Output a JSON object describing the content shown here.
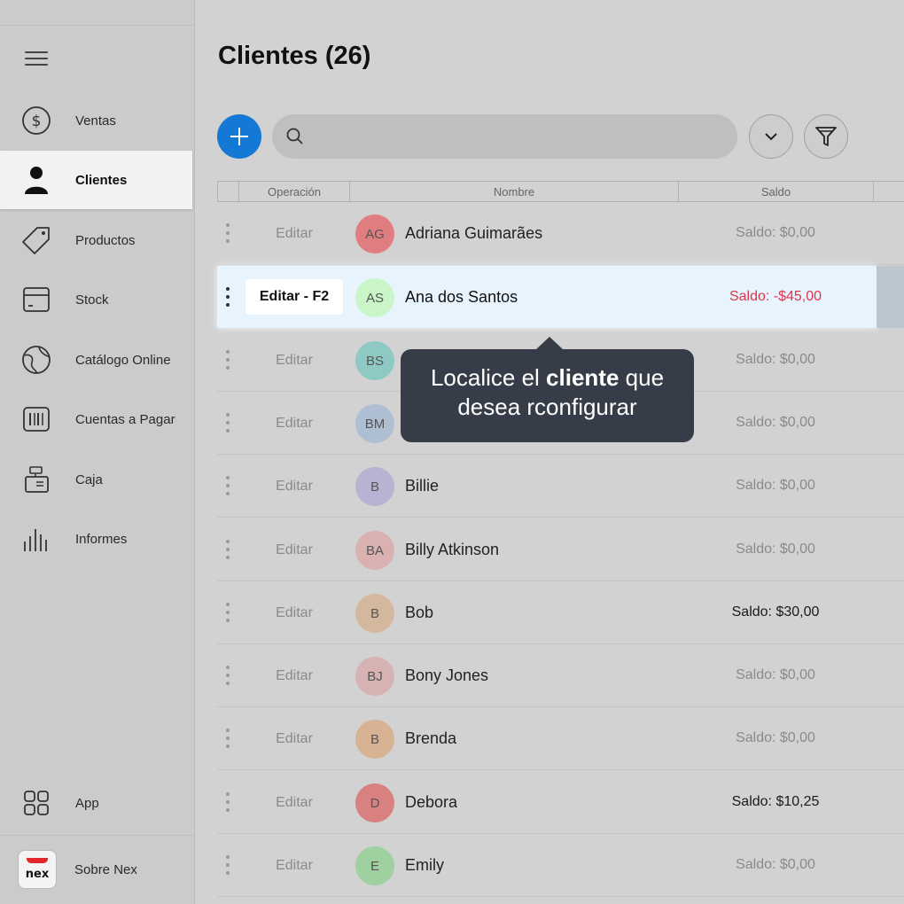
{
  "sidebar": {
    "items": [
      {
        "label": "Ventas",
        "icon": "dollar-circle-icon"
      },
      {
        "label": "Clientes",
        "icon": "person-icon"
      },
      {
        "label": "Productos",
        "icon": "tag-icon"
      },
      {
        "label": "Stock",
        "icon": "box-icon"
      },
      {
        "label": "Catálogo Online",
        "icon": "globe-icon"
      },
      {
        "label": "Cuentas a Pagar",
        "icon": "barcode-icon"
      },
      {
        "label": "Caja",
        "icon": "cash-register-icon"
      },
      {
        "label": "Informes",
        "icon": "bars-icon"
      }
    ],
    "active": "Clientes",
    "app_label": "App",
    "about_label": "Sobre Nex",
    "logo_text": "nex"
  },
  "main": {
    "title": "Clientes (26)",
    "search_placeholder": ""
  },
  "table": {
    "headers": [
      "Operación",
      "Nombre",
      "Saldo"
    ],
    "rows": [
      {
        "edit": "Editar",
        "initials": "AG",
        "name": "Adriana Guimarães",
        "saldo": "Saldo: $0,00",
        "avatar_color": "#e07d80",
        "saldo_style": "muted"
      },
      {
        "edit": "Editar - F2",
        "initials": "AS",
        "name": "Ana dos Santos",
        "saldo": "Saldo: -$45,00",
        "avatar_color": "#c9f5c8",
        "saldo_style": "negative",
        "highlighted": true
      },
      {
        "edit": "Editar",
        "initials": "BS",
        "name": "",
        "saldo": "Saldo: $0,00",
        "avatar_color": "#8ec9c4",
        "saldo_style": "muted"
      },
      {
        "edit": "Editar",
        "initials": "BM",
        "name": "",
        "saldo": "Saldo: $0,00",
        "avatar_color": "#aebfd3",
        "saldo_style": "muted"
      },
      {
        "edit": "Editar",
        "initials": "B",
        "name": "Billie",
        "saldo": "Saldo: $0,00",
        "avatar_color": "#b7b4d3",
        "saldo_style": "muted"
      },
      {
        "edit": "Editar",
        "initials": "BA",
        "name": "Billy Atkinson",
        "saldo": "Saldo: $0,00",
        "avatar_color": "#d9b1b1",
        "saldo_style": "muted"
      },
      {
        "edit": "Editar",
        "initials": "B",
        "name": "Bob",
        "saldo": "Saldo: $30,00",
        "avatar_color": "#d3b89d",
        "saldo_style": "positive"
      },
      {
        "edit": "Editar",
        "initials": "BJ",
        "name": "Bony Jones",
        "saldo": "Saldo: $0,00",
        "avatar_color": "#d7b2b2",
        "saldo_style": "muted"
      },
      {
        "edit": "Editar",
        "initials": "B",
        "name": "Brenda",
        "saldo": "Saldo: $0,00",
        "avatar_color": "#d8b393",
        "saldo_style": "muted"
      },
      {
        "edit": "Editar",
        "initials": "D",
        "name": "Debora",
        "saldo": "Saldo: $10,25",
        "avatar_color": "#d98080",
        "saldo_style": "positive"
      },
      {
        "edit": "Editar",
        "initials": "E",
        "name": "Emily",
        "saldo": "Saldo: $0,00",
        "avatar_color": "#9ed0a0",
        "saldo_style": "muted"
      }
    ]
  },
  "tooltip": {
    "line1_pre": "Localice el ",
    "line1_bold": "cliente",
    "line1_post": " que",
    "line2": "desea rconfigurar"
  },
  "colors": {
    "accent": "#1479d4",
    "negative": "#e0344a",
    "tooltip_bg": "#363d48",
    "highlight_bg": "#e8f4fd"
  }
}
